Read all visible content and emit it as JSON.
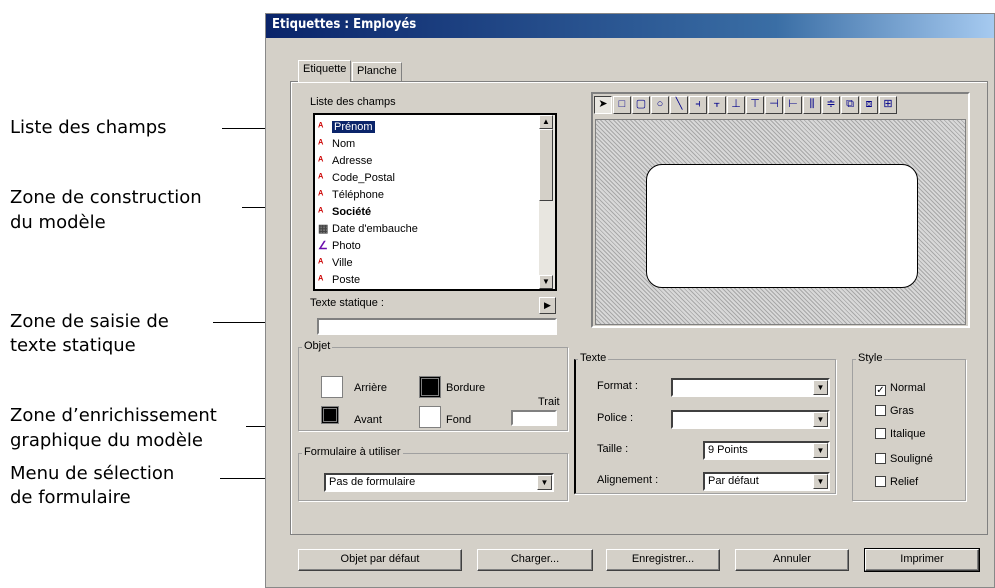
{
  "callouts": {
    "liste": "Liste des champs",
    "zone_construction_1": "Zone de construction",
    "zone_construction_2": "du modèle",
    "zone_saisie_1": "Zone de saisie de",
    "zone_saisie_2": "texte statique",
    "zone_enrich_1": "Zone d’enrichissement",
    "zone_enrich_2": "graphique du modèle",
    "menu_1": "Menu de sélection",
    "menu_2": "de formulaire"
  },
  "window": {
    "title": "Etiquettes : Employés"
  },
  "tabs": [
    {
      "label": "Etiquette"
    },
    {
      "label": "Planche"
    }
  ],
  "fields": {
    "label": "Liste des champs",
    "items": [
      {
        "label": "Prénom",
        "icon": "text-field-icon"
      },
      {
        "label": "Nom",
        "icon": "text-field-icon"
      },
      {
        "label": "Adresse",
        "icon": "text-field-icon"
      },
      {
        "label": "Code_Postal",
        "icon": "text-field-icon"
      },
      {
        "label": "Téléphone",
        "icon": "text-field-icon"
      },
      {
        "label": "Société",
        "icon": "text-field-icon"
      },
      {
        "label": "Date d'embauche",
        "icon": "date-field-icon"
      },
      {
        "label": "Photo",
        "icon": "picture-field-icon"
      },
      {
        "label": "Ville",
        "icon": "text-field-icon"
      },
      {
        "label": "Poste",
        "icon": "text-field-icon"
      }
    ]
  },
  "static_text": {
    "label": "Texte statique :",
    "value": ""
  },
  "objet": {
    "label": "Objet",
    "arriere": "Arrière",
    "bordure": "Bordure",
    "avant": "Avant",
    "fond": "Fond",
    "trait": "Trait"
  },
  "formulaire": {
    "label": "Formulaire à utiliser",
    "value": "Pas de formulaire"
  },
  "texte": {
    "label": "Texte",
    "format_label": "Format :",
    "format_value": "",
    "police_label": "Police :",
    "police_value": "",
    "taille_label": "Taille :",
    "taille_value": "9 Points",
    "alignement_label": "Alignement :",
    "alignement_value": "Par défaut"
  },
  "style": {
    "label": "Style",
    "normal": "Normal",
    "gras": "Gras",
    "italique": "Italique",
    "souligne": "Souligné",
    "relief": "Relief"
  },
  "buttons": {
    "defaut": "Objet par défaut",
    "charger": "Charger...",
    "enregistrer": "Enregistrer...",
    "annuler": "Annuler",
    "imprimer": "Imprimer"
  },
  "colors": {
    "title_bar": "#0a246a",
    "selection": "#0a246a",
    "window_bg": "#d4d0c8"
  }
}
